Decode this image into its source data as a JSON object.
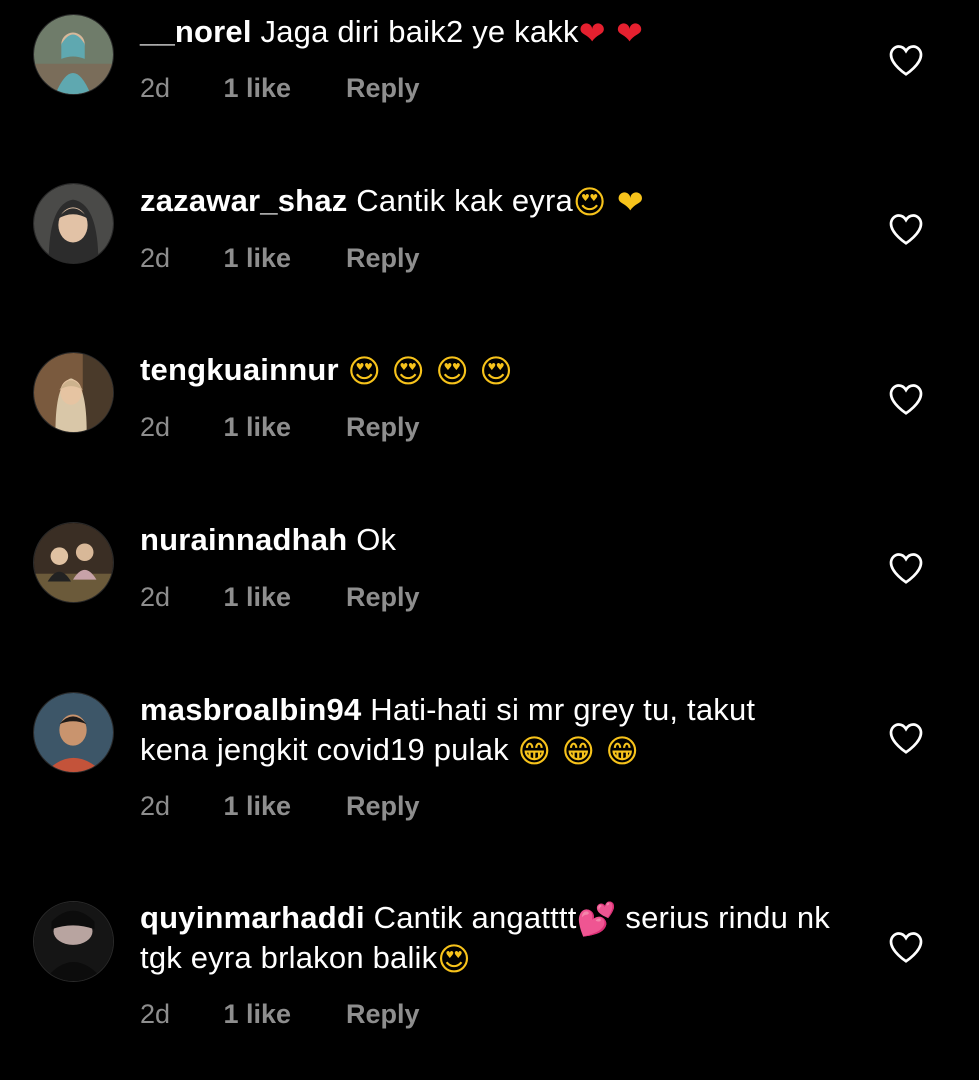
{
  "comments": [
    {
      "username": "__norel",
      "text": "Jaga diri baik2 ye kakk",
      "emoji": "❤ ❤",
      "time": "2d",
      "likes": "1 like",
      "reply": "Reply",
      "avatar_color": "#5b8a8a"
    },
    {
      "username": "zazawar_shaz",
      "text": "Cantik kak eyra",
      "emoji": "😍 ❤",
      "time": "2d",
      "likes": "1 like",
      "reply": "Reply",
      "avatar_color": "#3a3a3a"
    },
    {
      "username": "tengkuainnur",
      "text": "",
      "emoji": "😍 😍 😍 😍",
      "time": "2d",
      "likes": "1 like",
      "reply": "Reply",
      "avatar_color": "#8a6a4a"
    },
    {
      "username": "nurainnadhah",
      "text": "Ok",
      "emoji": "",
      "time": "2d",
      "likes": "1 like",
      "reply": "Reply",
      "avatar_color": "#5a4a3a"
    },
    {
      "username": "masbroalbin94",
      "text": "Hati-hati si mr grey tu, takut kena jengkit covid19 pulak",
      "emoji": "😁 😁 😁",
      "time": "2d",
      "likes": "1 like",
      "reply": "Reply",
      "avatar_color": "#4a5a6a"
    },
    {
      "username": "quyinmarhaddi",
      "text": "Cantik angatttt",
      "emoji_mid": "💕",
      "text2": "serius rindu nk tgk eyra brlakon balik",
      "emoji": "😍",
      "time": "2d",
      "likes": "1 like",
      "reply": "Reply",
      "avatar_color": "#1a1a1a"
    }
  ],
  "colors": {
    "background": "#000000",
    "primary_text": "#ffffff",
    "secondary_text": "#8e8e8e",
    "heart_emoji": "#e5202f"
  },
  "icons": {
    "like": "heart-outline-icon"
  }
}
